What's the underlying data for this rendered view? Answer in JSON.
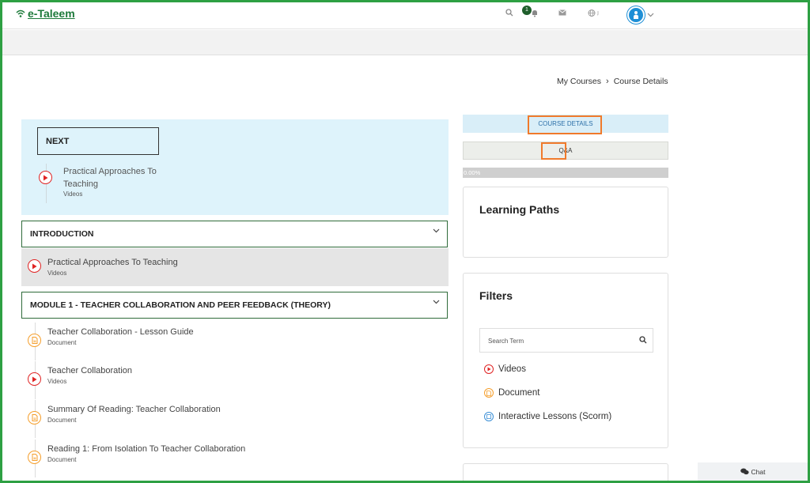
{
  "app": {
    "logo_text": "e-Taleem"
  },
  "topbar": {
    "notification_count": "1"
  },
  "breadcrumb": {
    "items": [
      "My Courses",
      "Course Details"
    ]
  },
  "next_panel": {
    "label": "NEXT",
    "item_title": "Practical Approaches To Teaching",
    "item_type": "Videos"
  },
  "sections": [
    {
      "title": "INTRODUCTION",
      "lessons": [
        {
          "title": "Practical Approaches To Teaching",
          "type": "Videos",
          "icon": "play-icon",
          "active": true
        }
      ]
    },
    {
      "title": "MODULE 1 - TEACHER COLLABORATION AND PEER FEEDBACK (THEORY)",
      "lessons": [
        {
          "title": "Teacher Collaboration - Lesson Guide",
          "type": "Document",
          "icon": "document-icon"
        },
        {
          "title": "Teacher Collaboration",
          "type": "Videos",
          "icon": "play-icon"
        },
        {
          "title": "Summary Of Reading: Teacher Collaboration",
          "type": "Document",
          "icon": "document-icon"
        },
        {
          "title": "Reading 1: From Isolation To Teacher Collaboration",
          "type": "Document",
          "icon": "document-icon"
        }
      ]
    }
  ],
  "tabs": {
    "course_details": "COURSE DETAILS",
    "qa": "Q&A"
  },
  "progress": {
    "label": "0.00%",
    "value": 0
  },
  "learning_paths": {
    "title": "Learning Paths"
  },
  "filters": {
    "title": "Filters",
    "search_placeholder": "Search Term",
    "items": [
      "Videos",
      "Document",
      "Interactive Lessons (Scorm)"
    ]
  },
  "chat": {
    "label": "Chat"
  },
  "colors": {
    "brand": "#1d7a3a",
    "frame": "#2ea043",
    "highlight": "#f07a2b",
    "video_red": "#e02424",
    "doc_orange": "#f59e2b"
  }
}
